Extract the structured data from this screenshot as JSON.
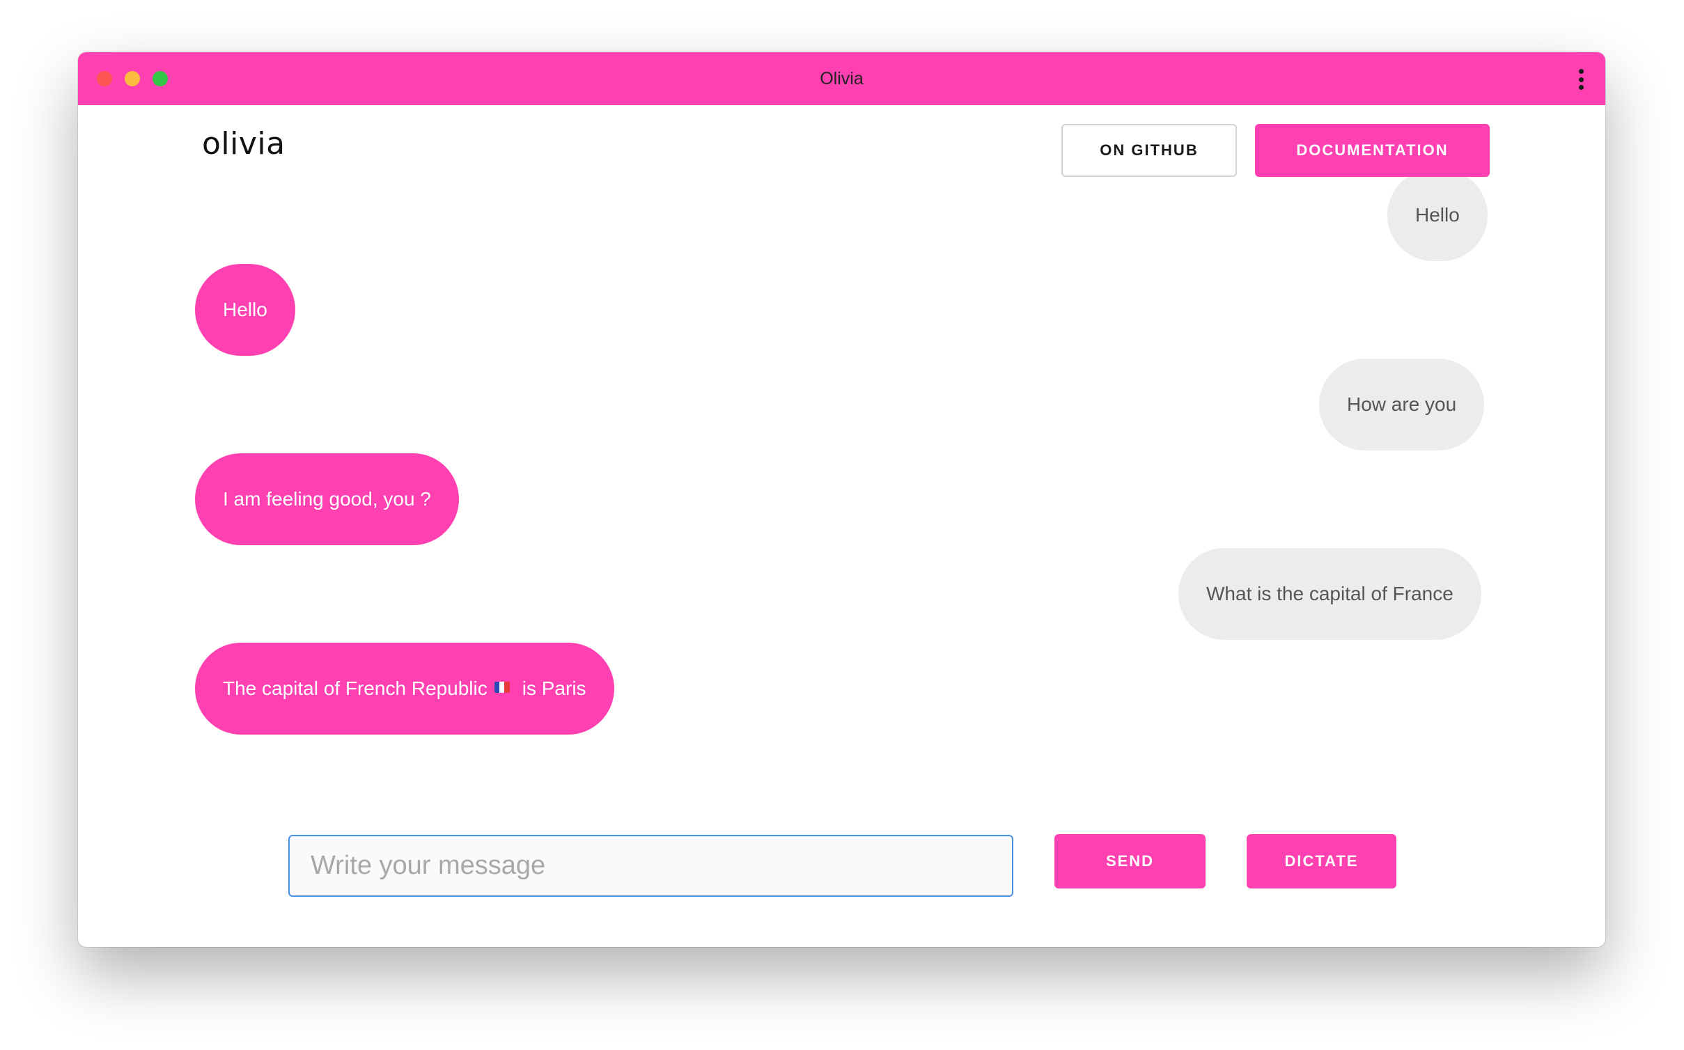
{
  "window": {
    "title": "Olivia",
    "accent_color": "#ff40b0"
  },
  "header": {
    "logo_text": "olivia",
    "github_label": "ON GITHUB",
    "docs_label": "DOCUMENTATION"
  },
  "messages": [
    {
      "sender": "user",
      "text": "Hello"
    },
    {
      "sender": "bot",
      "text": "Hello"
    },
    {
      "sender": "user",
      "text": "How are you"
    },
    {
      "sender": "bot",
      "text": "I am feeling good, you ?"
    },
    {
      "sender": "user",
      "text": "What is the capital of France"
    },
    {
      "sender": "bot",
      "text_before": "The capital of French Republic",
      "flag": "france-flag-icon",
      "text_after": "is Paris"
    }
  ],
  "composer": {
    "placeholder": "Write your message",
    "value": "",
    "send_label": "SEND",
    "dictate_label": "DICTATE"
  }
}
